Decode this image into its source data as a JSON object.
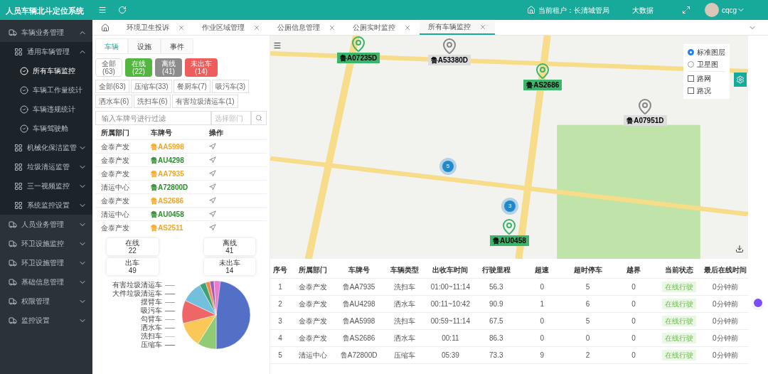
{
  "header": {
    "title": "人员车辆北斗定位系统",
    "tenant": "当前租户：长清城管局",
    "bigdata": "大数据",
    "user": "cqcg"
  },
  "sidebar": {
    "items": [
      {
        "label": "车辆业务管理",
        "expanded": true,
        "selected": false,
        "children": [
          {
            "label": "通用车辆管理",
            "expanded": true,
            "selected": false,
            "children": [
              {
                "label": "所有车辆监控",
                "selected": true
              },
              {
                "label": "车辆工作量统计",
                "selected": false
              },
              {
                "label": "车辆违规统计",
                "selected": false
              },
              {
                "label": "车辆驾驶舱",
                "selected": false
              }
            ]
          },
          {
            "label": "机械化保洁监管",
            "expanded": false,
            "selected": false
          },
          {
            "label": "垃圾清运监管",
            "expanded": false,
            "selected": false
          },
          {
            "label": "三一视频监控",
            "expanded": false,
            "selected": false
          },
          {
            "label": "系统监控设置",
            "expanded": false,
            "selected": false
          }
        ]
      },
      {
        "label": "人员业务管理",
        "expanded": false,
        "selected": false
      },
      {
        "label": "环卫设施监控",
        "expanded": false,
        "selected": false
      },
      {
        "label": "环卫设施管理",
        "expanded": false,
        "selected": false
      },
      {
        "label": "基础信息管理",
        "expanded": false,
        "selected": false
      },
      {
        "label": "权限管理",
        "expanded": false,
        "selected": false
      },
      {
        "label": "监控设置",
        "expanded": false,
        "selected": false
      }
    ]
  },
  "page_tabs": [
    {
      "label": "环境卫生投诉",
      "selected": false
    },
    {
      "label": "作业区域管理",
      "selected": false
    },
    {
      "label": "公厕信息管理",
      "selected": false
    },
    {
      "label": "公厕实时监控",
      "selected": false
    },
    {
      "label": "所有车辆监控",
      "selected": true
    }
  ],
  "panel_tabs": [
    {
      "label": "车辆",
      "selected": true
    },
    {
      "label": "设施",
      "selected": false
    },
    {
      "label": "事件",
      "selected": false
    }
  ],
  "status_filters": [
    {
      "kind": "all",
      "label": "全部",
      "count": "(63)"
    },
    {
      "kind": "online",
      "label": "在线",
      "count": "(22)"
    },
    {
      "kind": "offline",
      "label": "离线",
      "count": "(41)"
    },
    {
      "kind": "notout",
      "label": "未出车",
      "count": "(14)"
    }
  ],
  "type_filters": [
    "全部(63)",
    "压缩车(33)",
    "餐厨车(7)",
    "吸污车(3)",
    "洒水车(6)",
    "洗扫车(6)",
    "有害垃圾清运车(1)"
  ],
  "search": {
    "placeholder": "输入车牌号进行过滤"
  },
  "dept_select": {
    "placeholder": "选择部门"
  },
  "vehicle_list": {
    "columns": [
      "所属部门",
      "车牌号",
      "操作"
    ],
    "rows": [
      {
        "dept": "金泰产发",
        "plate": "鲁AA5998",
        "color": "#f5a623"
      },
      {
        "dept": "金泰产发",
        "plate": "鲁AU4298",
        "color": "#2e8b2e"
      },
      {
        "dept": "金泰产发",
        "plate": "鲁AA7935",
        "color": "#f5a623"
      },
      {
        "dept": "清运中心",
        "plate": "鲁A72800D",
        "color": "#2e8b2e"
      },
      {
        "dept": "金泰产发",
        "plate": "鲁AS2686",
        "color": "#f5a623"
      },
      {
        "dept": "清运中心",
        "plate": "鲁AU0458",
        "color": "#2e8b2e"
      },
      {
        "dept": "金泰产发",
        "plate": "鲁AS2511",
        "color": "#f5a623"
      }
    ]
  },
  "stats": [
    {
      "label": "在线",
      "value": "22"
    },
    {
      "label": "离线",
      "value": "41"
    },
    {
      "label": "出车",
      "value": "49"
    },
    {
      "label": "未出车",
      "value": "14"
    }
  ],
  "pie_labels": [
    {
      "label": "有害垃圾清运车",
      "color": "#ea7ccc"
    },
    {
      "label": "大件垃圾清运车",
      "color": "#9a60b4"
    },
    {
      "label": "摆臂车",
      "color": "#fc8452"
    },
    {
      "label": "吸污车",
      "color": "#3ba272"
    },
    {
      "label": "勾臂车",
      "color": "#73c0de"
    },
    {
      "label": "洒水车",
      "color": "#ee6666"
    },
    {
      "label": "洗扫车",
      "color": "#fac858"
    },
    {
      "label": "压缩车",
      "color": "#5470c6"
    }
  ],
  "map": {
    "markers": [
      {
        "plate": "鲁A07235D",
        "online": true
      },
      {
        "plate": "鲁A53380D",
        "online": false
      },
      {
        "plate": "鲁AS2686",
        "online": true
      },
      {
        "plate": "鲁A07951D",
        "online": false
      },
      {
        "plate": "鲁AU0458",
        "online": true
      }
    ],
    "clusters": [
      "5",
      "3"
    ],
    "layers": [
      {
        "label": "标准图层",
        "selected": true
      },
      {
        "label": "卫星图",
        "selected": false
      }
    ],
    "overlays": [
      {
        "label": "路网",
        "checked": false
      },
      {
        "label": "路况",
        "checked": false
      }
    ]
  },
  "table": {
    "columns": [
      "序号",
      "所属部门",
      "车牌号",
      "车辆类型",
      "出收车时间",
      "行驶里程",
      "超速",
      "超时停车",
      "越界",
      "当前状态",
      "最后在线时间"
    ],
    "rows": [
      [
        "1",
        "金泰产发",
        "鲁AA7935",
        "洗扫车",
        "01:00~11:14",
        "56.3",
        "0",
        "5",
        "0",
        "在线行驶",
        "0分钟前"
      ],
      [
        "2",
        "金泰产发",
        "鲁AU4298",
        "洒水车",
        "00:11~10:42",
        "90.9",
        "1",
        "6",
        "0",
        "在线行驶",
        "0分钟前"
      ],
      [
        "3",
        "金泰产发",
        "鲁AA5998",
        "洗扫车",
        "00:59~11:14",
        "67.5",
        "0",
        "5",
        "0",
        "在线行驶",
        "0分钟前"
      ],
      [
        "4",
        "金泰产发",
        "鲁AS2686",
        "洒水车",
        "00:11",
        "86.3",
        "0",
        "0",
        "0",
        "在线行驶",
        "0分钟前"
      ],
      [
        "5",
        "清运中心",
        "鲁A72800D",
        "压缩车",
        "05:39",
        "73.3",
        "9",
        "2",
        "0",
        "在线行驶",
        "0分钟前"
      ]
    ]
  }
}
